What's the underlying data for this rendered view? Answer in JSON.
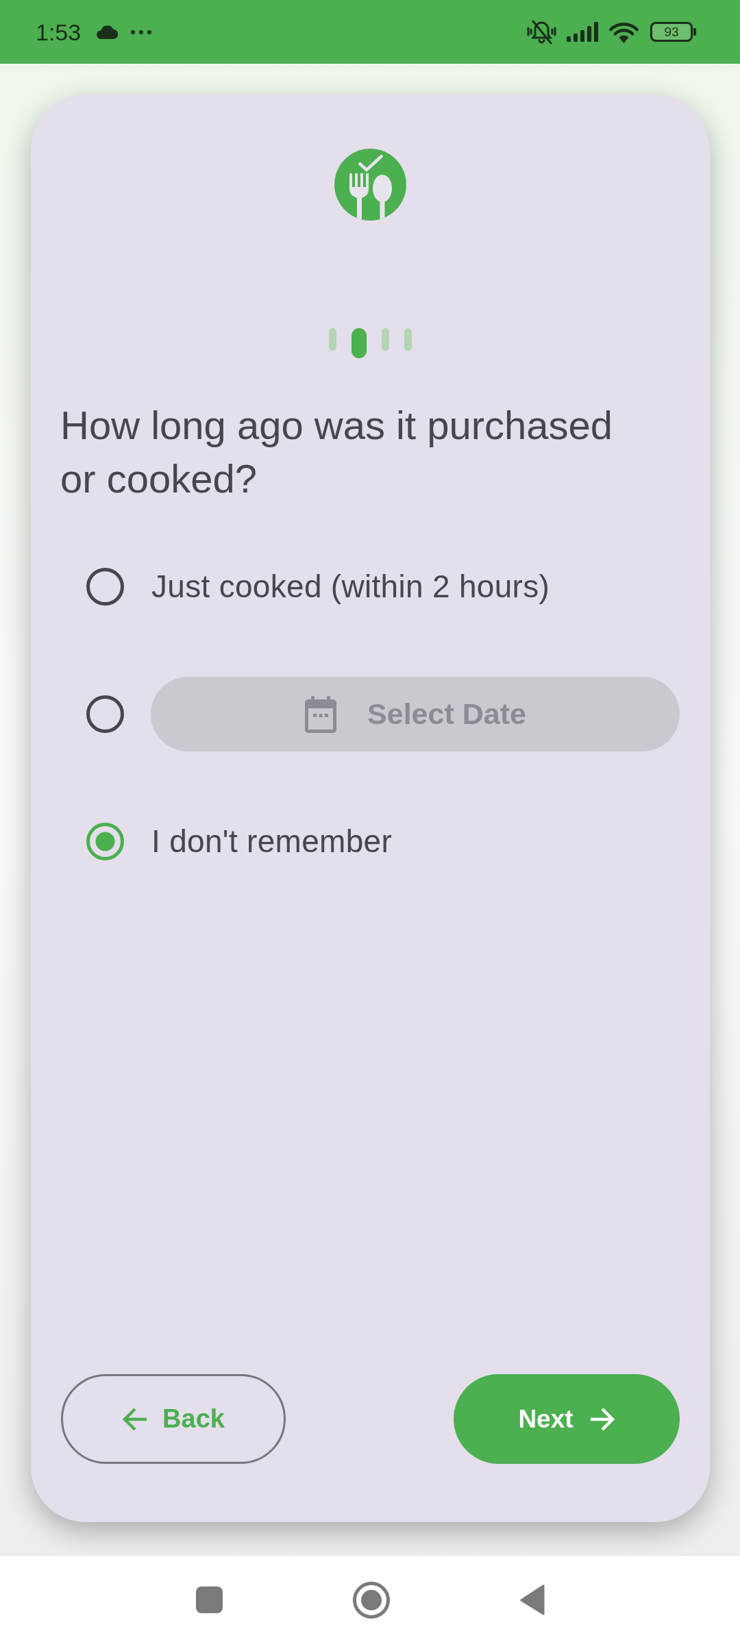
{
  "status_bar": {
    "time": "1:53",
    "battery": "93"
  },
  "steps": [
    {
      "selected": false
    },
    {
      "selected": true
    },
    {
      "selected": false
    },
    {
      "selected": false
    }
  ],
  "question": "How long ago was it purchased or cooked?",
  "options": [
    {
      "kind": "text",
      "label": "Just cooked (within 2 hours)",
      "selected": false
    },
    {
      "kind": "date",
      "label": "Select Date",
      "disabled": true,
      "selected": false
    },
    {
      "kind": "text",
      "label": "I don't remember",
      "selected": true
    }
  ],
  "buttons": [
    {
      "kind": "outlined",
      "label": "Back"
    },
    {
      "kind": "filled",
      "label": "Next"
    }
  ]
}
